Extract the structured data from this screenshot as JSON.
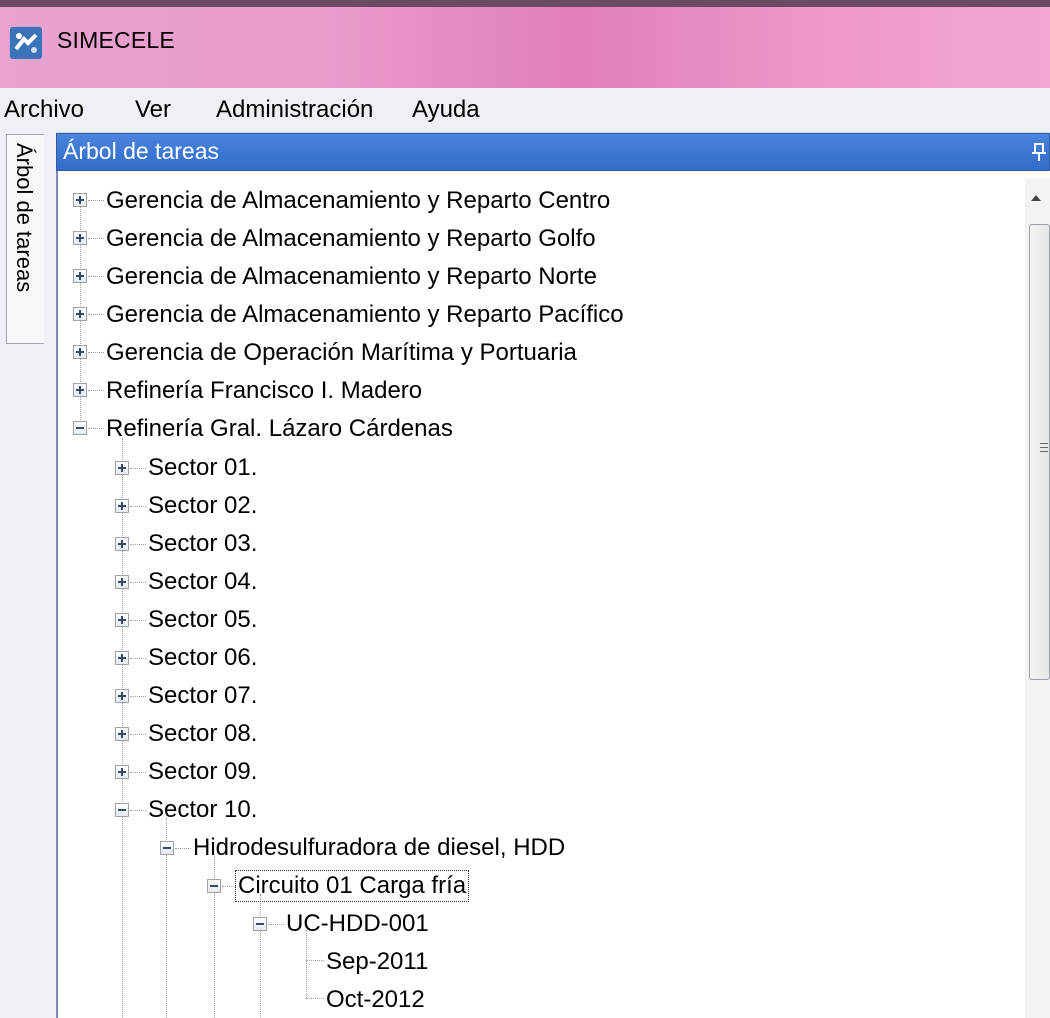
{
  "window": {
    "title": "SIMECELE",
    "icon": "simecele-logo-icon"
  },
  "menu": [
    "Archivo",
    "Ver",
    "Administración",
    "Ayuda"
  ],
  "side_tab": {
    "label": "Árbol de tareas"
  },
  "panel": {
    "title": "Árbol de tareas",
    "pin_icon": "pin-icon"
  },
  "tree": {
    "gerencias": [
      "Gerencia de Almacenamiento y Reparto Centro",
      "Gerencia de Almacenamiento y Reparto Golfo",
      "Gerencia de Almacenamiento y Reparto Norte",
      "Gerencia de Almacenamiento y Reparto Pacífico",
      "Gerencia de Operación Marítima y Portuaria",
      "Refinería Francisco I. Madero"
    ],
    "refineria": "Refinería Gral. Lázaro Cárdenas",
    "sectores": [
      "Sector 01.",
      "Sector 02.",
      "Sector 03.",
      "Sector 04.",
      "Sector 05.",
      "Sector 06.",
      "Sector 07.",
      "Sector 08.",
      "Sector 09.",
      "Sector 10."
    ],
    "planta": "Hidrodesulfuradora de diesel, HDD",
    "circuito": "Circuito 01 Carga fría",
    "unidad": "UC-HDD-001",
    "fechas": [
      "Sep-2011",
      "Oct-2012"
    ]
  }
}
